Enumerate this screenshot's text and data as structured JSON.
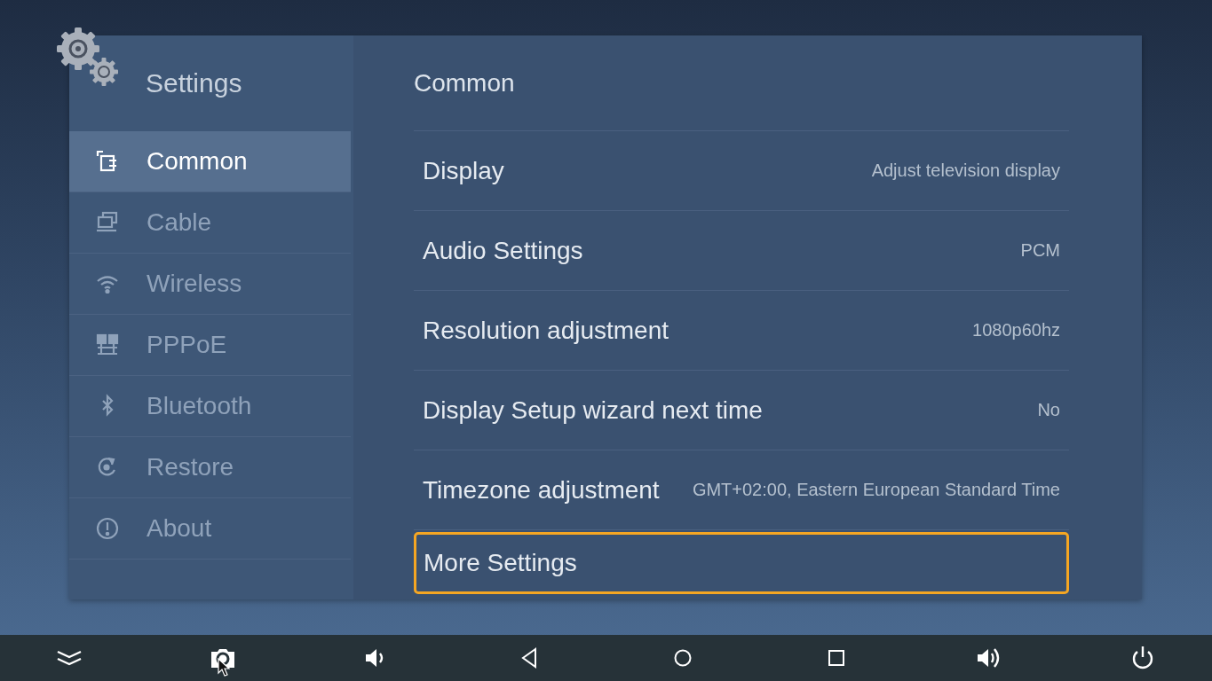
{
  "sidebar": {
    "title": "Settings",
    "items": [
      {
        "label": "Common",
        "selected": true
      },
      {
        "label": "Cable",
        "selected": false
      },
      {
        "label": "Wireless",
        "selected": false
      },
      {
        "label": "PPPoE",
        "selected": false
      },
      {
        "label": "Bluetooth",
        "selected": false
      },
      {
        "label": "Restore",
        "selected": false
      },
      {
        "label": "About",
        "selected": false
      }
    ]
  },
  "content": {
    "title": "Common",
    "rows": [
      {
        "label": "Display",
        "value": "Adjust television display",
        "selected": false
      },
      {
        "label": "Audio Settings",
        "value": "PCM",
        "selected": false
      },
      {
        "label": "Resolution adjustment",
        "value": "1080p60hz",
        "selected": false
      },
      {
        "label": "Display Setup wizard next time",
        "value": "No",
        "selected": false
      },
      {
        "label": "Timezone adjustment",
        "value": "GMT+02:00, Eastern European Standard Time",
        "selected": false
      },
      {
        "label": "More Settings",
        "selected": true
      }
    ]
  }
}
